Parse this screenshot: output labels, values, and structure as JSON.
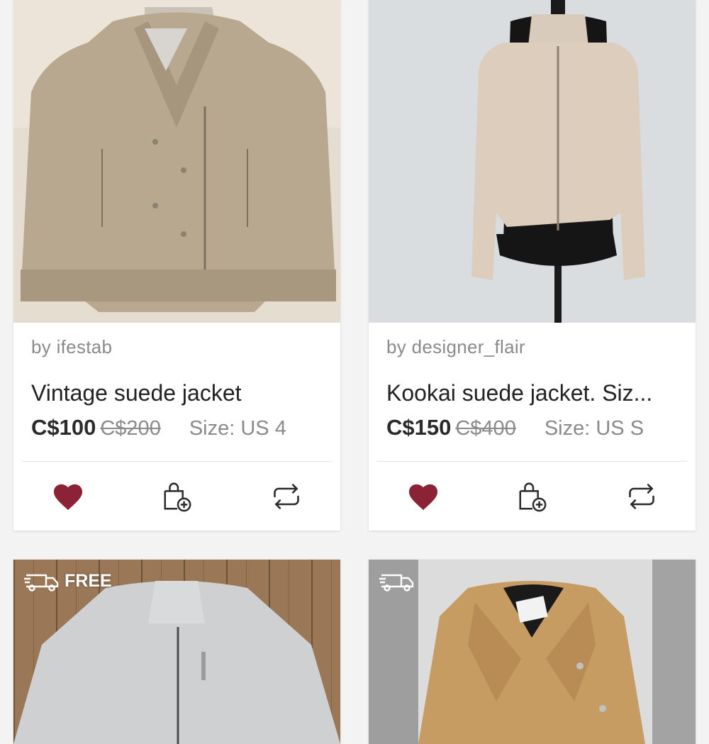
{
  "listings": [
    {
      "seller": "by ifestab",
      "title": "Vintage suede jacket",
      "price": "C$100",
      "original_price": "C$200",
      "size": "Size: US 4",
      "liked": true,
      "image_desc": "beige suede biker jacket on wooden hanger"
    },
    {
      "seller": "by designer_flair",
      "title": "Kookai suede jacket. Siz...",
      "price": "C$150",
      "original_price": "C$400",
      "size": "Size: US S",
      "liked": true,
      "image_desc": "light beige suede jacket on black dress form"
    },
    {
      "shipping_badge": "FREE",
      "image_desc": "light grey suede zip jacket on hanger over wood floor"
    },
    {
      "shipping_badge": "",
      "image_desc": "camel suede biker jacket on hanger"
    }
  ],
  "colors": {
    "like": "#8b2236",
    "icon": "#2a2a2a",
    "muted_text": "#8a8a8a"
  },
  "icons": {
    "like": "heart-icon",
    "bag": "add-to-bag-icon",
    "share": "repost-icon",
    "shipping": "shipping-truck-icon"
  }
}
